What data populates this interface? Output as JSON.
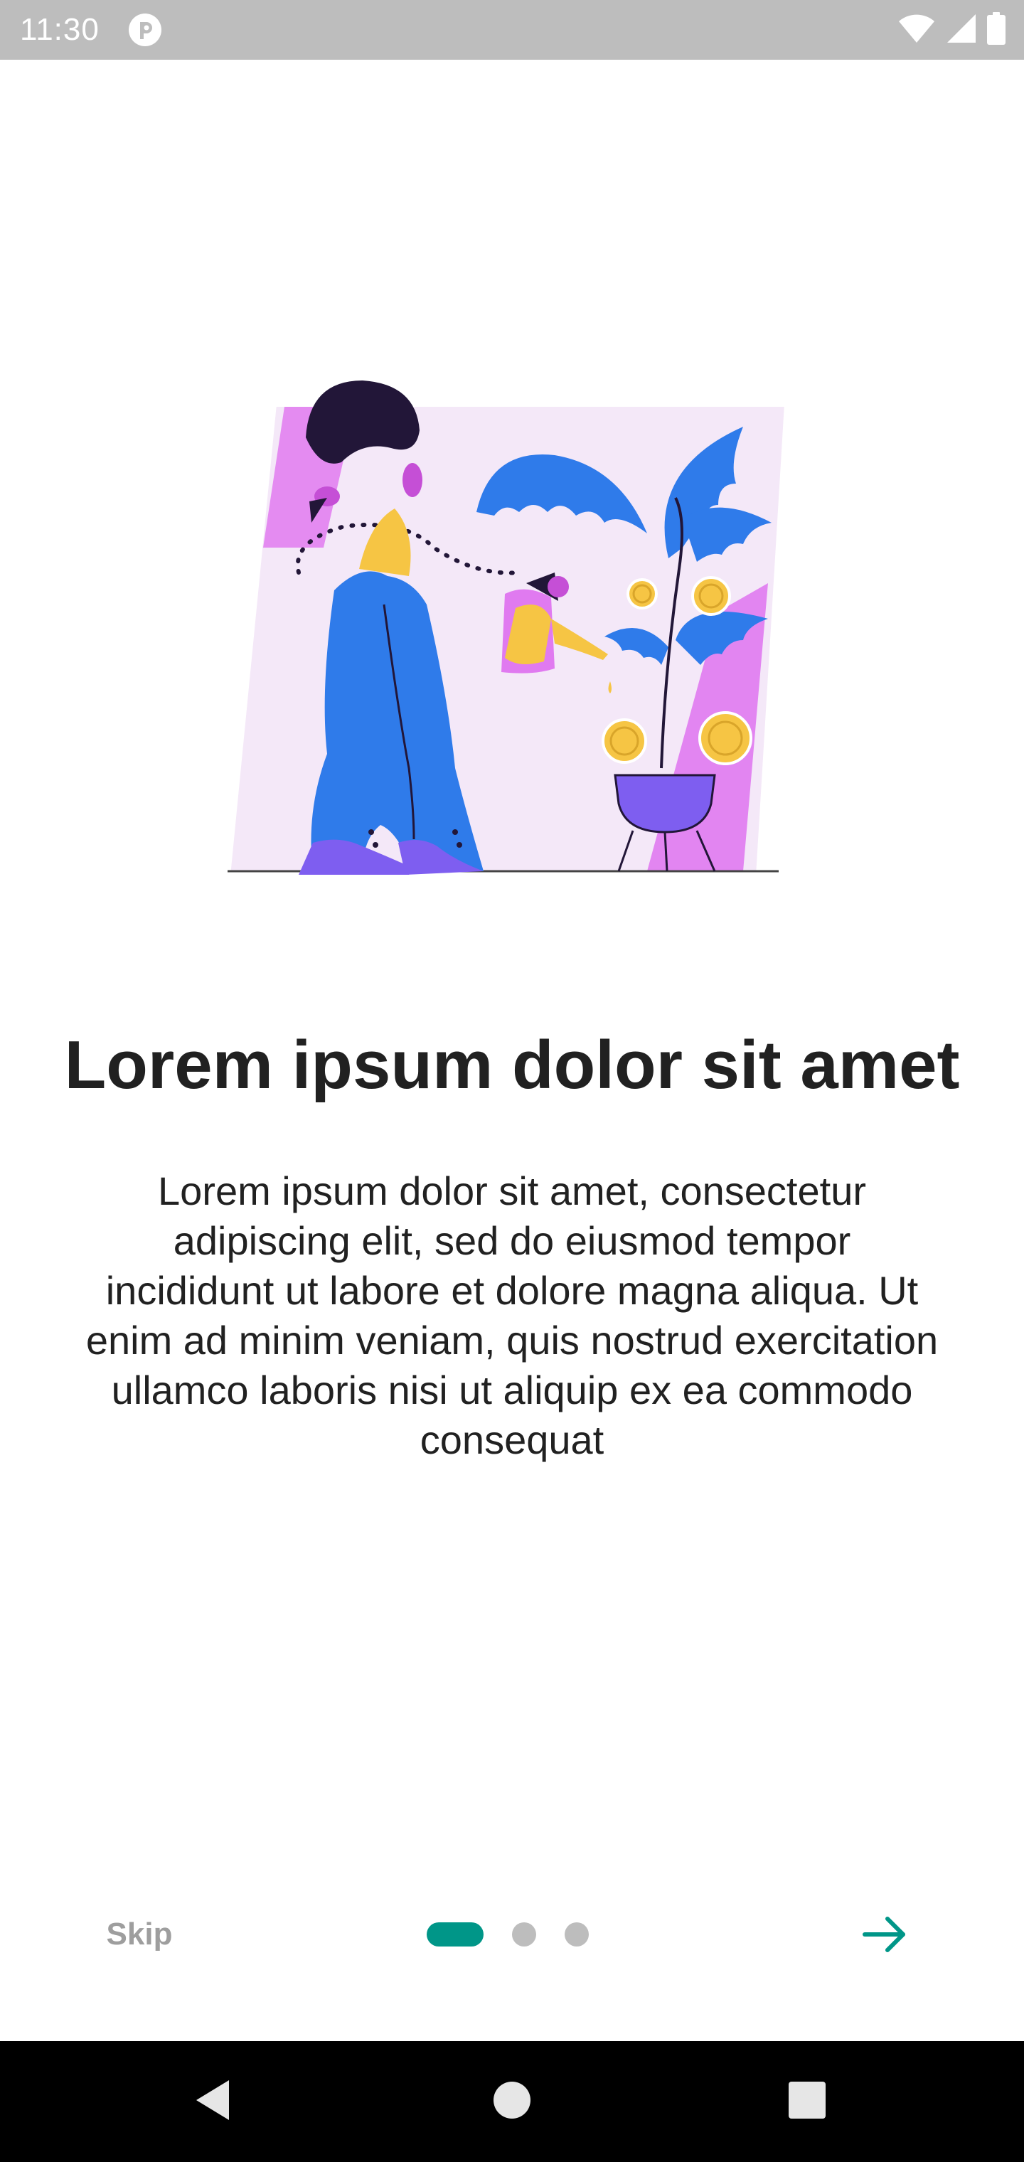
{
  "status_bar": {
    "time": "11:30",
    "icons": [
      "app-notification-icon",
      "wifi-icon",
      "cell-signal-icon",
      "battery-icon"
    ]
  },
  "onboarding": {
    "illustration": "woman-watering-money-plant-illustration",
    "title": "Lorem ipsum dolor sit amet",
    "description": "Lorem ipsum dolor sit amet, consectetur adipiscing elit, sed do eiusmod tempor incididunt ut labore et dolore magna aliqua. Ut enim ad minim veniam, quis nostrud exercitation ullamco laboris nisi ut aliquip ex ea commodo consequat"
  },
  "controls": {
    "skip_label": "Skip",
    "page_count": 3,
    "current_page": 1,
    "next_icon": "arrow-right-icon"
  },
  "nav_bar": {
    "icons": [
      "back-icon",
      "home-icon",
      "recents-icon"
    ]
  },
  "colors": {
    "accent": "#009688",
    "status_bar": "#bdbdbd",
    "indicator_inactive": "#bdbdbd",
    "skip_text": "#9e9e9e",
    "illustration_blue": "#2f7bea",
    "illustration_magenta": "#e07af0",
    "illustration_lavender": "#f4e8f8",
    "illustration_gold": "#f6c544"
  }
}
